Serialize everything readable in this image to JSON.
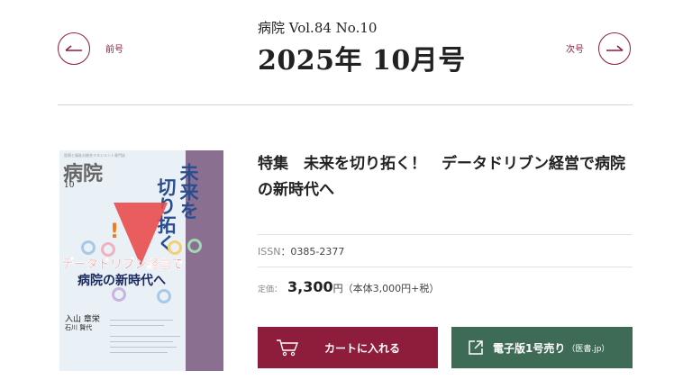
{
  "header": {
    "volume": "病院 Vol.84 No.10",
    "issue_title": "2025年 10月号",
    "prev_label": "前号",
    "next_label": "次号"
  },
  "cover": {
    "publisher_line": "医療と福祉の総合マネジメント専門誌",
    "magazine_name": "病院",
    "issue_number": "10",
    "headline_vertical_1": "未来を",
    "headline_vertical_2": "切り拓く",
    "exclamation": "!",
    "headline_band_1": "データドリブン経営で",
    "headline_band_2": "病院の新時代へ",
    "author_1": "入山 章栄",
    "author_2": "石川 賢代"
  },
  "product": {
    "title": "特集　未来を切り拓く！　データドリブン経営で病院の新時代へ",
    "issn_label": "ISSN",
    "issn_value": "：0385-2377",
    "price_label": "定価：",
    "price_amount": "3,300",
    "price_unit": "円",
    "price_note": "（本体3,000円+税）"
  },
  "buttons": {
    "cart_label": "カートに入れる",
    "ebook_label": "電子版1号売り",
    "ebook_sub": "（医書.jp）"
  },
  "colors": {
    "accent": "#8e1d3b",
    "ebook": "#3e6b56"
  }
}
